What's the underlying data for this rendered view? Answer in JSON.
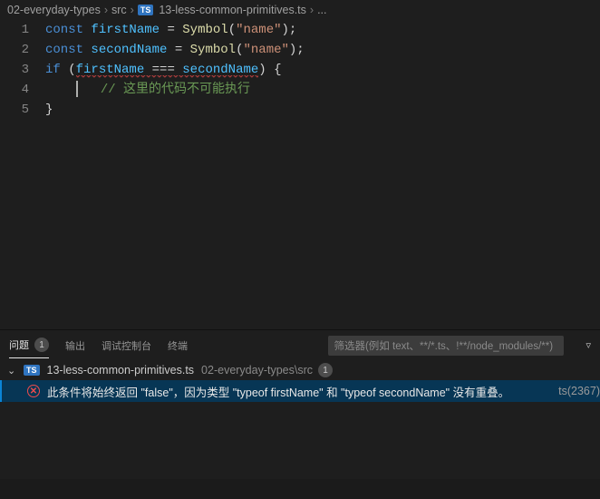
{
  "breadcrumbs": {
    "folder": "02-everyday-types",
    "sub": "src",
    "file": "13-less-common-primitives.ts",
    "ellipsis": "..."
  },
  "code": {
    "l1": {
      "kw": "const",
      "var": "firstName",
      "eq": " = ",
      "fn": "Symbol",
      "open": "(",
      "str": "\"name\"",
      "close": ");"
    },
    "l2": {
      "kw": "const",
      "var": "secondName",
      "eq": " = ",
      "fn": "Symbol",
      "open": "(",
      "str": "\"name\"",
      "close": ");"
    },
    "l3": {
      "kw": "if",
      "open": " (",
      "a": "firstName",
      "op": " === ",
      "b": "secondName",
      "close": ") {"
    },
    "l4": {
      "cmt": "// 这里的代码不可能执行"
    },
    "l5": {
      "close": "}"
    }
  },
  "lineNumbers": {
    "n1": "1",
    "n2": "2",
    "n3": "3",
    "n4": "4",
    "n5": "5"
  },
  "panel": {
    "tabs": {
      "problems": "问题",
      "output": "输出",
      "debug": "调试控制台",
      "terminal": "终端"
    },
    "problemCount": "1",
    "filterPlaceholder": "筛选器(例如 text、**/*.ts、!**/node_modules/**)"
  },
  "problems": {
    "fileName": "13-less-common-primitives.ts",
    "filePath": "02-everyday-types\\src",
    "fileCount": "1",
    "items": [
      {
        "message": "此条件将始终返回 \"false\"，因为类型 \"typeof firstName\" 和 \"typeof secondName\" 没有重叠。",
        "code": "ts(2367)"
      }
    ]
  }
}
